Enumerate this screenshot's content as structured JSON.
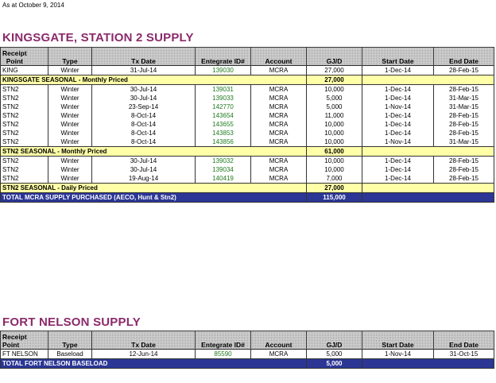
{
  "as_at": "As at October 9, 2014",
  "headers": [
    "Receipt\nPoint",
    "Type",
    "Tx Date",
    "Entegrate ID#",
    "Account",
    "GJ/D",
    "Start Date",
    "End Date"
  ],
  "kingsgate": {
    "title": "KINGSGATE, STATION 2 SUPPLY",
    "first_row": [
      "KING",
      "Winter",
      "31-Jul-14",
      "139030",
      "MCRA",
      "27,000",
      "1-Dec-14",
      "28-Feb-15"
    ],
    "group1": {
      "label": "KINGSGATE SEASONAL - Monthly Priced",
      "total": "27,000",
      "rows": [
        [
          "STN2",
          "Winter",
          "30-Jul-14",
          "139031",
          "MCRA",
          "10,000",
          "1-Dec-14",
          "28-Feb-15"
        ],
        [
          "STN2",
          "Winter",
          "30-Jul-14",
          "139033",
          "MCRA",
          "5,000",
          "1-Dec-14",
          "31-Mar-15"
        ],
        [
          "STN2",
          "Winter",
          "23-Sep-14",
          "142770",
          "MCRA",
          "5,000",
          "1-Nov-14",
          "31-Mar-15"
        ],
        [
          "STN2",
          "Winter",
          "8-Oct-14",
          "143654",
          "MCRA",
          "11,000",
          "1-Dec-14",
          "28-Feb-15"
        ],
        [
          "STN2",
          "Winter",
          "8-Oct-14",
          "143655",
          "MCRA",
          "10,000",
          "1-Dec-14",
          "28-Feb-15"
        ],
        [
          "STN2",
          "Winter",
          "8-Oct-14",
          "143853",
          "MCRA",
          "10,000",
          "1-Dec-14",
          "28-Feb-15"
        ],
        [
          "STN2",
          "Winter",
          "8-Oct-14",
          "143856",
          "MCRA",
          "10,000",
          "1-Nov-14",
          "31-Mar-15"
        ]
      ]
    },
    "group2": {
      "label": "STN2 SEASONAL - Monthly Priced",
      "total": "61,000",
      "rows": [
        [
          "STN2",
          "Winter",
          "30-Jul-14",
          "139032",
          "MCRA",
          "10,000",
          "1-Dec-14",
          "28-Feb-15"
        ],
        [
          "STN2",
          "Winter",
          "30-Jul-14",
          "139034",
          "MCRA",
          "10,000",
          "1-Dec-14",
          "28-Feb-15"
        ],
        [
          "STN2",
          "Winter",
          "19-Aug-14",
          "140419",
          "MCRA",
          "7,000",
          "1-Dec-14",
          "28-Feb-15"
        ]
      ]
    },
    "daily_label": "STN2 SEASONAL - Daily Priced",
    "daily_total": "27,000",
    "grand_label": "TOTAL MCRA SUPPLY PURCHASED (AECO, Hunt & Stn2)",
    "grand_total": "115,000"
  },
  "fortnelson": {
    "title": "FORT NELSON SUPPLY",
    "row": [
      "FT NELSON",
      "Baseload",
      "12-Jun-14",
      "85590",
      "MCRA",
      "5,000",
      "1-Nov-14",
      "31-Oct-15"
    ],
    "total_label": "TOTAL FORT NELSON BASELOAD",
    "total": "5,000"
  }
}
